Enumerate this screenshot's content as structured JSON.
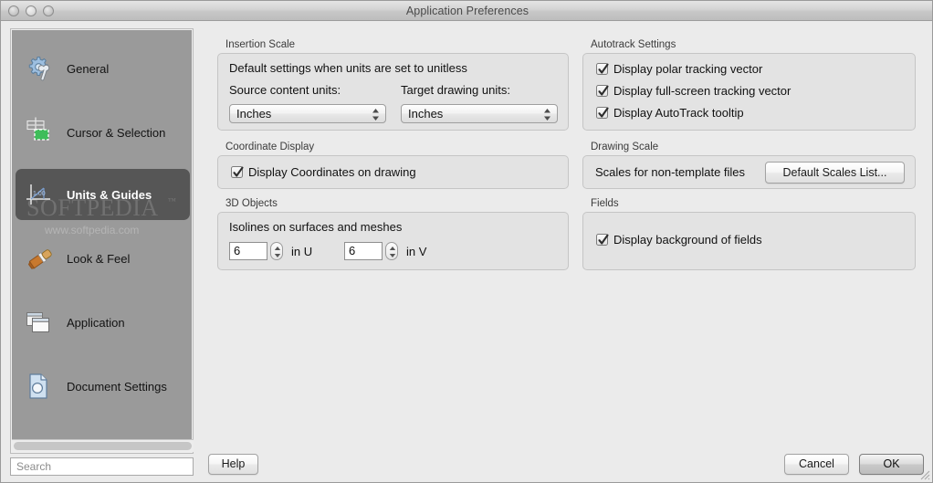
{
  "window": {
    "title": "Application Preferences",
    "traffic_lights": [
      "close",
      "minimize",
      "zoom"
    ]
  },
  "sidebar": {
    "items": [
      {
        "label": "General",
        "icon": "gear-wrench-icon",
        "selected": false
      },
      {
        "label": "Cursor & Selection",
        "icon": "crosshair-icon",
        "selected": false
      },
      {
        "label": "Units & Guides",
        "icon": "ruler-axis-icon",
        "selected": true
      },
      {
        "label": "Look & Feel",
        "icon": "paintbrush-icon",
        "selected": false
      },
      {
        "label": "Application",
        "icon": "windows-stack-icon",
        "selected": false
      },
      {
        "label": "Document Settings",
        "icon": "document-icon",
        "selected": false
      }
    ],
    "scrollbar": "horizontal-scrollbar"
  },
  "search": {
    "placeholder": "Search",
    "value": ""
  },
  "watermark": {
    "main": "SOFTPEDIA",
    "tm": "™",
    "sub": "www.softpedia.com"
  },
  "groups": {
    "insertion_scale": {
      "title": "Insertion Scale",
      "description": "Default settings when units are set to unitless",
      "source_label": "Source content units:",
      "source_value": "Inches",
      "target_label": "Target drawing units:",
      "target_value": "Inches"
    },
    "coordinate_display": {
      "title": "Coordinate Display",
      "checkbox_label": "Display Coordinates on drawing",
      "checked": true
    },
    "objects_3d": {
      "title": "3D Objects",
      "description": "Isolines on surfaces and meshes",
      "u_value": "6",
      "u_label": "in U",
      "v_value": "6",
      "v_label": "in V"
    },
    "autotrack": {
      "title": "Autotrack Settings",
      "options": [
        {
          "label": "Display polar tracking vector",
          "checked": true
        },
        {
          "label": "Display full-screen tracking vector",
          "checked": true
        },
        {
          "label": "Display AutoTrack tooltip",
          "checked": true
        }
      ]
    },
    "drawing_scale": {
      "title": "Drawing Scale",
      "description": "Scales for non-template files",
      "button_label": "Default Scales List..."
    },
    "fields": {
      "title": "Fields",
      "checkbox_label": "Display background of fields",
      "checked": true
    }
  },
  "footer": {
    "help_label": "Help",
    "cancel_label": "Cancel",
    "ok_label": "OK"
  },
  "colors": {
    "window_bg": "#ebebeb",
    "sidebar_bg": "#9a9a9a",
    "sidebar_selected": "#565656",
    "group_bg": "#e3e3e3",
    "group_border": "#c5c5c5"
  }
}
